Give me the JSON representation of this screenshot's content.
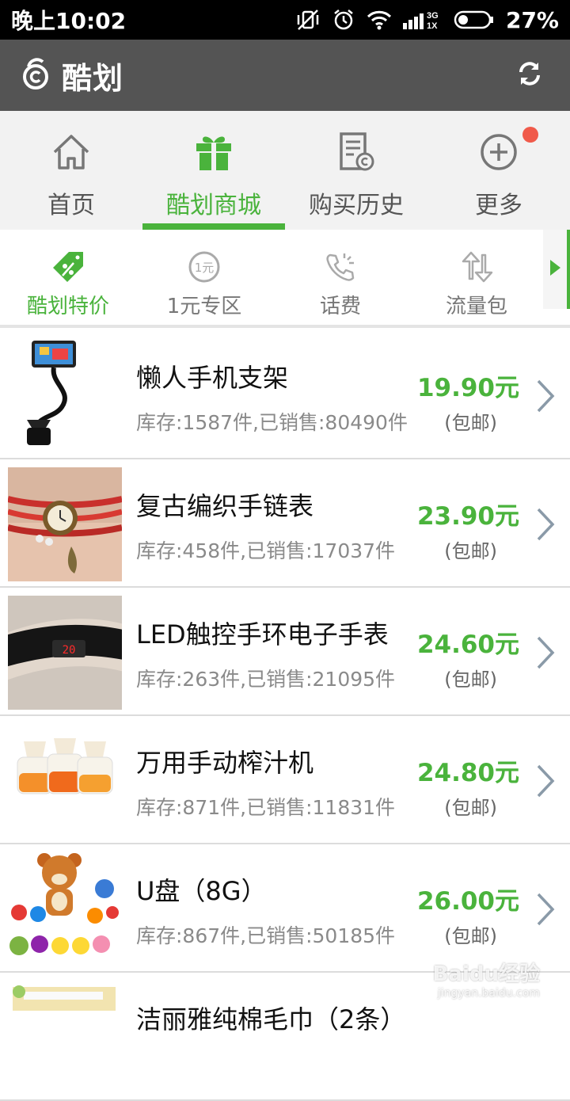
{
  "status_bar": {
    "time": "晚上10:02",
    "network": "3G\n1X",
    "battery": "27%"
  },
  "app_bar": {
    "title": "酷划"
  },
  "main_tabs": [
    {
      "label": "首页",
      "icon": "home-icon"
    },
    {
      "label": "酷划商城",
      "icon": "gift-icon",
      "active": true
    },
    {
      "label": "购买历史",
      "icon": "receipt-icon"
    },
    {
      "label": "更多",
      "icon": "plus-circle-icon",
      "badge": true
    }
  ],
  "categories": [
    {
      "label": "酷划特价",
      "icon": "discount-tag-icon",
      "active": true
    },
    {
      "label": "1元专区",
      "icon": "one-yuan-icon"
    },
    {
      "label": "话费",
      "icon": "phone-icon"
    },
    {
      "label": "流量包",
      "icon": "data-arrows-icon"
    }
  ],
  "products": [
    {
      "name": "懒人手机支架",
      "stock": "库存:1587件,已销售:80490件",
      "price": "19.90元",
      "shipping": "(包邮)"
    },
    {
      "name": "复古编织手链表",
      "stock": "库存:458件,已销售:17037件",
      "price": "23.90元",
      "shipping": "(包邮)"
    },
    {
      "name": "LED触控手环电子手表",
      "stock": "库存:263件,已销售:21095件",
      "price": "24.60元",
      "shipping": "(包邮)"
    },
    {
      "name": "万用手动榨汁机",
      "stock": "库存:871件,已销售:11831件",
      "price": "24.80元",
      "shipping": "(包邮)"
    },
    {
      "name": "U盘（8G）",
      "stock": "库存:867件,已销售:50185件",
      "price": "26.00元",
      "shipping": "(包邮)"
    },
    {
      "name": "洁丽雅纯棉毛巾（2条）",
      "stock": "",
      "price": "",
      "shipping": ""
    }
  ],
  "watermark": {
    "line1": "Baidu经验",
    "line2": "jingyan.baidu.com"
  },
  "colors": {
    "accent": "#4ab33c",
    "appbar": "#545454",
    "badge": "#f05a4a"
  }
}
